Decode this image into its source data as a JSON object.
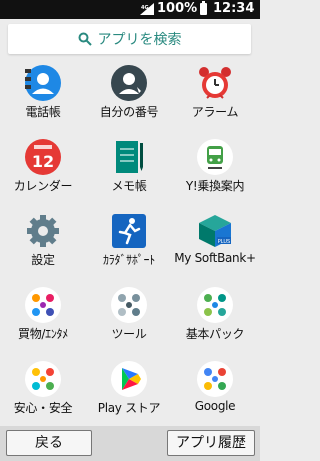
{
  "status": {
    "battery": "100%",
    "time": "12:34"
  },
  "search": {
    "label": "アプリを検索"
  },
  "apps": [
    {
      "label": "電話帳",
      "icon": "contacts-icon"
    },
    {
      "label": "自分の番号",
      "icon": "my-number-icon"
    },
    {
      "label": "アラーム",
      "icon": "alarm-clock-icon"
    },
    {
      "label": "カレンダー",
      "icon": "calendar-icon"
    },
    {
      "label": "メモ帳",
      "icon": "notepad-icon"
    },
    {
      "label": "Y!乗換案内",
      "icon": "train-icon"
    },
    {
      "label": "設定",
      "icon": "settings-gear-icon"
    },
    {
      "label": "ｶﾗﾀﾞｻﾎﾟｰﾄ",
      "icon": "running-person-icon"
    },
    {
      "label": "My SoftBank+",
      "icon": "softbank-icon"
    },
    {
      "label": "買物/ｴﾝﾀﾒ",
      "icon": "folder-shopping-icon"
    },
    {
      "label": "ツール",
      "icon": "folder-tools-icon"
    },
    {
      "label": "基本パック",
      "icon": "folder-basic-pack-icon"
    },
    {
      "label": "安心・安全",
      "icon": "folder-safety-icon"
    },
    {
      "label": "Play ストア",
      "icon": "play-store-icon"
    },
    {
      "label": "Google",
      "icon": "folder-google-icon"
    }
  ],
  "bottom": {
    "back": "戻る",
    "history": "アプリ履歴"
  },
  "colors": {
    "accent": "#2a8a80",
    "statusbar": "#111111"
  }
}
